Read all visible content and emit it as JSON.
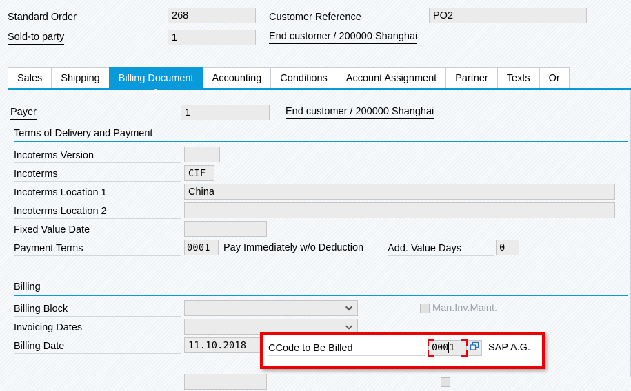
{
  "header": {
    "order_type_label": "Standard Order",
    "order_number": "268",
    "sold_to_label": "Sold-to party",
    "sold_to_value": "1",
    "customer_reference_label": "Customer Reference",
    "customer_reference_value": "PO2",
    "customer_description": "End customer / 200000 Shanghai"
  },
  "tabs": [
    {
      "label": "Sales",
      "active": false
    },
    {
      "label": "Shipping",
      "active": false
    },
    {
      "label": "Billing Document",
      "active": true
    },
    {
      "label": "Accounting",
      "active": false
    },
    {
      "label": "Conditions",
      "active": false
    },
    {
      "label": "Account Assignment",
      "active": false
    },
    {
      "label": "Partner",
      "active": false
    },
    {
      "label": "Texts",
      "active": false
    },
    {
      "label": "Or",
      "active": false
    }
  ],
  "payer": {
    "label": "Payer",
    "value": "1",
    "description": "End customer / 200000 Shanghai"
  },
  "sections": {
    "terms": {
      "title": "Terms of Delivery and Payment",
      "fields": {
        "incoterms_version_label": "Incoterms Version",
        "incoterms_version_value": "",
        "incoterms_label": "Incoterms",
        "incoterms_value": "CIF",
        "incoterms_loc1_label": "Incoterms Location 1",
        "incoterms_loc1_value": "China",
        "incoterms_loc2_label": "Incoterms Location 2",
        "incoterms_loc2_value": "",
        "fixed_value_date_label": "Fixed Value Date",
        "fixed_value_date_value": "",
        "payment_terms_label": "Payment Terms",
        "payment_terms_value": "0001",
        "payment_terms_description": "Pay Immediately w/o Deduction",
        "add_value_days_label": "Add. Value Days",
        "add_value_days_value": "0"
      }
    },
    "billing": {
      "title": "Billing",
      "fields": {
        "billing_block_label": "Billing Block",
        "billing_block_value": "",
        "invoicing_dates_label": "Invoicing Dates",
        "invoicing_dates_value": "",
        "billing_date_label": "Billing Date",
        "billing_date_value": "11.10.2018",
        "man_inv_maint_label": "Man.Inv.Maint.",
        "man_inv_maint_checked": false,
        "ccode_to_be_billed_label": "CCode to Be Billed",
        "ccode_to_be_billed_value_before_caret": "000",
        "ccode_to_be_billed_value_after_caret": "1",
        "ccode_to_be_billed_description": "SAP A.G."
      }
    }
  },
  "icons": {
    "dropdown_arrow": "chevron-down-icon",
    "value_help": "value-help-icon"
  },
  "colors": {
    "accent_blue": "#089ada",
    "highlight_red": "#ee0000",
    "focus_red": "#e8000b",
    "field_bg": "#ebebeb",
    "field_border": "#c6c6c6"
  }
}
